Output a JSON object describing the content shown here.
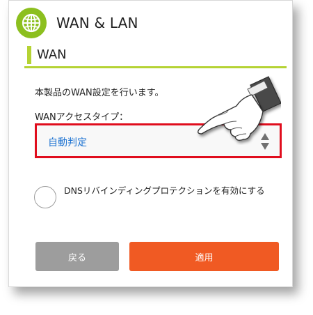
{
  "header": {
    "title": "WAN & LAN",
    "icon": "globe-icon"
  },
  "section": {
    "title": "WAN"
  },
  "description": "本製品のWAN設定を行います。",
  "wan_access_type": {
    "label": "WANアクセスタイプ：",
    "selected": "自動判定"
  },
  "dns_rebinding": {
    "label": "DNSリバインディングプロテクションを有効にする",
    "checked": false
  },
  "buttons": {
    "back": "戻る",
    "apply": "適用"
  },
  "colors": {
    "accent_green": "#8cbf1f",
    "section_green": "#b5d334",
    "highlight_red": "#e00d1d",
    "link_blue": "#1f74d2",
    "apply_orange": "#f05a23",
    "back_gray": "#9d9d9d"
  }
}
